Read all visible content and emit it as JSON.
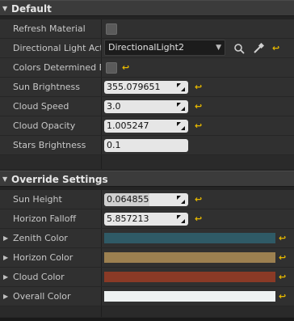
{
  "categories": {
    "default": "Default",
    "override": "Override Settings"
  },
  "default_rows": {
    "refresh_material": {
      "label": "Refresh Material",
      "checked": false
    },
    "directional_light_actor": {
      "label": "Directional Light Actor",
      "value": "DirectionalLight2"
    },
    "colors_determined_by": {
      "label": "Colors Determined By",
      "checked": false
    },
    "sun_brightness": {
      "label": "Sun Brightness",
      "value": "355.079651"
    },
    "cloud_speed": {
      "label": "Cloud Speed",
      "value": "3.0"
    },
    "cloud_opacity": {
      "label": "Cloud Opacity",
      "value": "1.005247"
    },
    "stars_brightness": {
      "label": "Stars Brightness",
      "value": "0.1"
    }
  },
  "override_rows": {
    "sun_height": {
      "label": "Sun Height",
      "value": "0.064855",
      "slider_fraction": 0.54
    },
    "horizon_falloff": {
      "label": "Horizon Falloff",
      "value": "5.857213"
    },
    "zenith_color": {
      "label": "Zenith Color",
      "color": "#2f5a66"
    },
    "horizon_color": {
      "label": "Horizon Color",
      "color": "#9c8050"
    },
    "cloud_color": {
      "label": "Cloud Color",
      "color": "#8a3a26"
    },
    "overall_color": {
      "label": "Overall Color",
      "color": "#eef2f2"
    }
  },
  "icons": {
    "category_expanded": "triangle-down-icon",
    "row_collapsed": "triangle-right-icon",
    "reset": "reset-arrow-icon",
    "browse": "magnifier-icon",
    "pick": "eyedropper-icon",
    "drag": "drag-arrows-icon"
  },
  "colors": {
    "reset_arrow": "#e6b800",
    "category_bg": "#3b3b3b",
    "row_bg": "#303030"
  }
}
